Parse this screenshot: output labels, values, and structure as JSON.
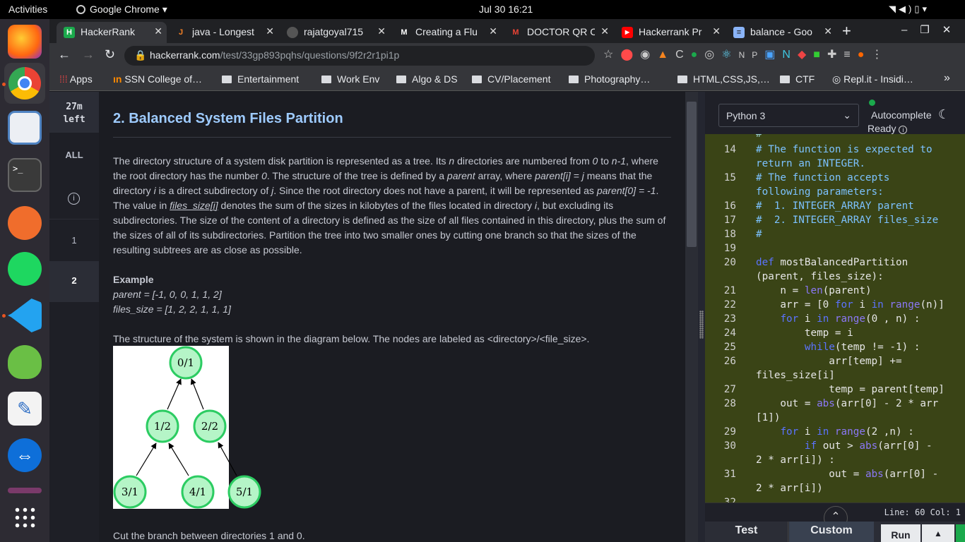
{
  "topbar": {
    "activities": "Activities",
    "app_menu": "Google Chrome",
    "clock": "Jul 30  16:21"
  },
  "tabs": [
    {
      "label": "HackerRank",
      "fav": "H",
      "favcolor": "#1ba94c"
    },
    {
      "label": "java - Longest",
      "fav": "J",
      "favcolor": "#f48024"
    },
    {
      "label": "rajatgoyal715",
      "fav": "",
      "favcolor": "#555"
    },
    {
      "label": "Creating a Flu",
      "fav": "M",
      "favcolor": "#ffffff"
    },
    {
      "label": "DOCTOR QR C",
      "fav": "M",
      "favcolor": "#ea4335"
    },
    {
      "label": "Hackerrank Pr",
      "fav": "▶",
      "favcolor": "#ff0000"
    },
    {
      "label": "balance - Goo",
      "fav": "≡",
      "favcolor": "#8ab4f8"
    }
  ],
  "address": {
    "host": "hackerrank.com",
    "path": "/test/33gp893pqhs/questions/9f2r2r1pi1p"
  },
  "bookmarks": {
    "apps": "Apps",
    "items": [
      "SSN College of…",
      "Entertainment",
      "Work Env",
      "Algo & DS",
      "CV/Placement",
      "Photography…",
      "HTML,CSS,JS,…",
      "CTF",
      "Repl.it - Insidi…"
    ],
    "more": "»"
  },
  "leftnav": {
    "timer_value": "27m",
    "timer_unit": "left",
    "all": "ALL",
    "q1": "1",
    "q2": "2"
  },
  "question": {
    "title": "2. Balanced System Files Partition",
    "example_heading": "Example",
    "example_parent": "parent = [-1, 0, 0, 1, 1, 2]",
    "example_files": "files_size = [1, 2, 2, 1, 1, 1]",
    "diagram_intro": "The structure of the system is shown in the diagram below. The nodes are labeled as <directory>/<file_size>.",
    "cut_text": "Cut the branch between directories 1 and 0."
  },
  "diagram": {
    "nodes": [
      "0/1",
      "1/2",
      "2/2",
      "3/1",
      "4/1",
      "5/1"
    ]
  },
  "editor": {
    "language": "Python 3",
    "autocomplete": "Autocomplete",
    "ready": "Ready",
    "status": "Line: 60 Col: 1",
    "test_tab": "Test",
    "custom_tab": "Custom",
    "run_button": "Run"
  }
}
